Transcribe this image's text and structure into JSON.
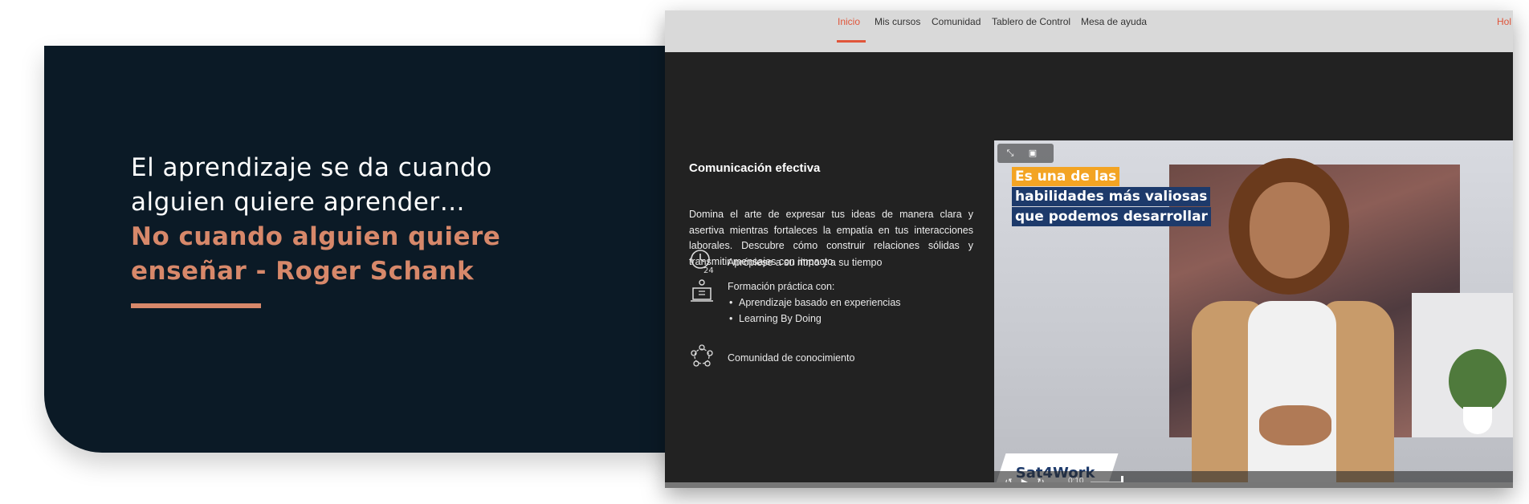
{
  "quote": {
    "line1": "El aprendizaje se da cuando",
    "line2": "alguien quiere aprender…",
    "line3": "No cuando alguien quiere",
    "line4": "enseñar - Roger Schank"
  },
  "nav": {
    "items": [
      "Inicio",
      "Mis cursos",
      "Comunidad",
      "Tablero de Control",
      "Mesa de ayuda"
    ],
    "active": "Inicio",
    "right_label": "Hol"
  },
  "course": {
    "title": "Comunicación efectiva",
    "description": "Domina el arte de expresar tus ideas de manera clara y asertiva mientras fortaleces la empatía en tus interacciones laborales. Descubre cómo construir relaciones sólidas y transmitir mensajes con impacto.",
    "features": [
      {
        "icon": "clock-24-icon",
        "text": "Aprópiese a su ritmo y a su tiempo"
      },
      {
        "icon": "laptop-teacher-icon",
        "text": "Formación práctica con:",
        "bullets": [
          "Aprendizaje basado en experiencias",
          "Learning By Doing"
        ]
      },
      {
        "icon": "community-network-icon",
        "text": "Comunidad de conocimiento"
      }
    ]
  },
  "video": {
    "overlay_lines": [
      "Es una de las",
      "habilidades más valiosas",
      "que podemos desarrollar"
    ],
    "logo_text": "Sat4Work",
    "time": "0:10",
    "progress": 0.6
  },
  "colors": {
    "banner": "#0b1a26",
    "accent": "#d7886a",
    "nav_active": "#e0553a",
    "window_bg": "#222222"
  }
}
